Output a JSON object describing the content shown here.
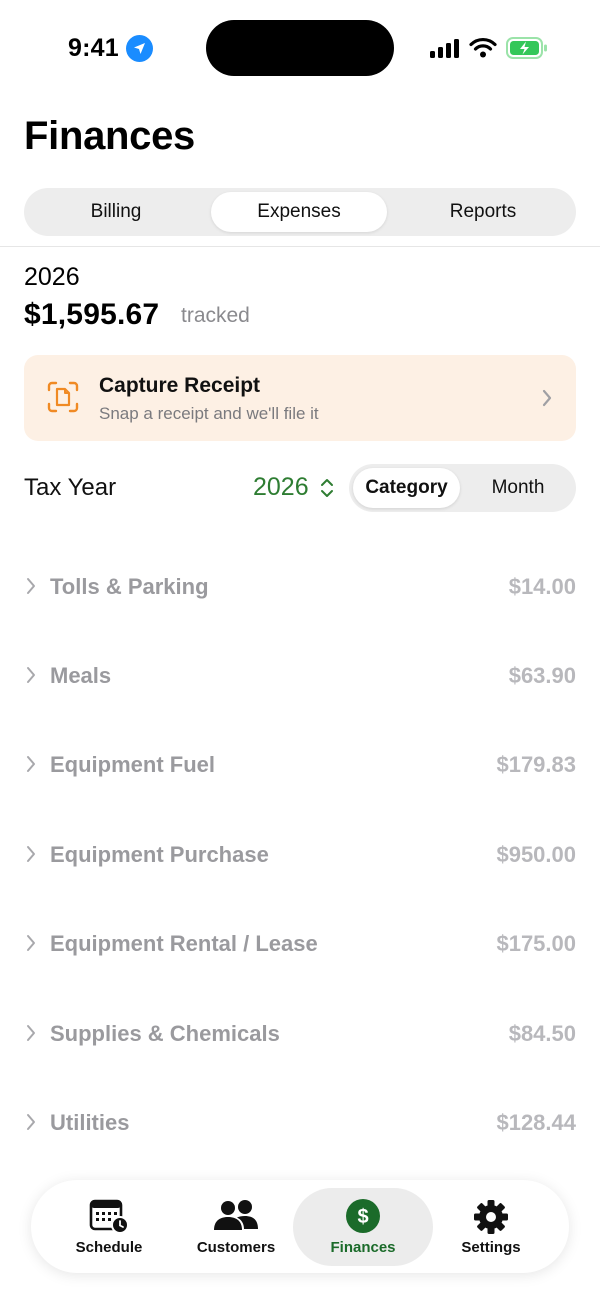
{
  "status_bar": {
    "time": "9:41",
    "icons": [
      "location-arrow-icon",
      "cellular-signal-icon",
      "wifi-icon",
      "battery-charging-icon"
    ]
  },
  "header": {
    "title": "Finances"
  },
  "tabs": [
    {
      "label": "Billing",
      "active": false
    },
    {
      "label": "Expenses",
      "active": true
    },
    {
      "label": "Reports",
      "active": false
    }
  ],
  "summary": {
    "year": "2026",
    "amount": "$1,595.67",
    "amount_suffix": "tracked"
  },
  "capture": {
    "title": "Capture Receipt",
    "subtitle": "Snap a receipt and we'll file it",
    "icon": "receipt-scan-icon"
  },
  "tax_year": {
    "label": "Tax Year",
    "value": "2026",
    "group_options": [
      {
        "label": "Category",
        "active": true
      },
      {
        "label": "Month",
        "active": false
      }
    ]
  },
  "expenses": [
    {
      "name": "Tolls & Parking",
      "amount": "$14.00"
    },
    {
      "name": "Meals",
      "amount": "$63.90"
    },
    {
      "name": "Equipment Fuel",
      "amount": "$179.83"
    },
    {
      "name": "Equipment Purchase",
      "amount": "$950.00"
    },
    {
      "name": "Equipment Rental / Lease",
      "amount": "$175.00"
    },
    {
      "name": "Supplies & Chemicals",
      "amount": "$84.50"
    },
    {
      "name": "Utilities",
      "amount": "$128.44"
    }
  ],
  "tabbar": [
    {
      "label": "Schedule",
      "icon": "calendar-clock-icon",
      "active": false
    },
    {
      "label": "Customers",
      "icon": "people-icon",
      "active": false
    },
    {
      "label": "Finances",
      "icon": "dollar-circle-icon",
      "active": true
    },
    {
      "label": "Settings",
      "icon": "gear-icon",
      "active": false
    }
  ],
  "colors": {
    "accent_green": "#2e7d32",
    "finances_icon_bg": "#1b6b2a",
    "capture_card_bg": "#fdf0e4",
    "capture_icon": "#f08a24",
    "location_blue": "#1a8cff",
    "battery_green": "#34c759"
  }
}
